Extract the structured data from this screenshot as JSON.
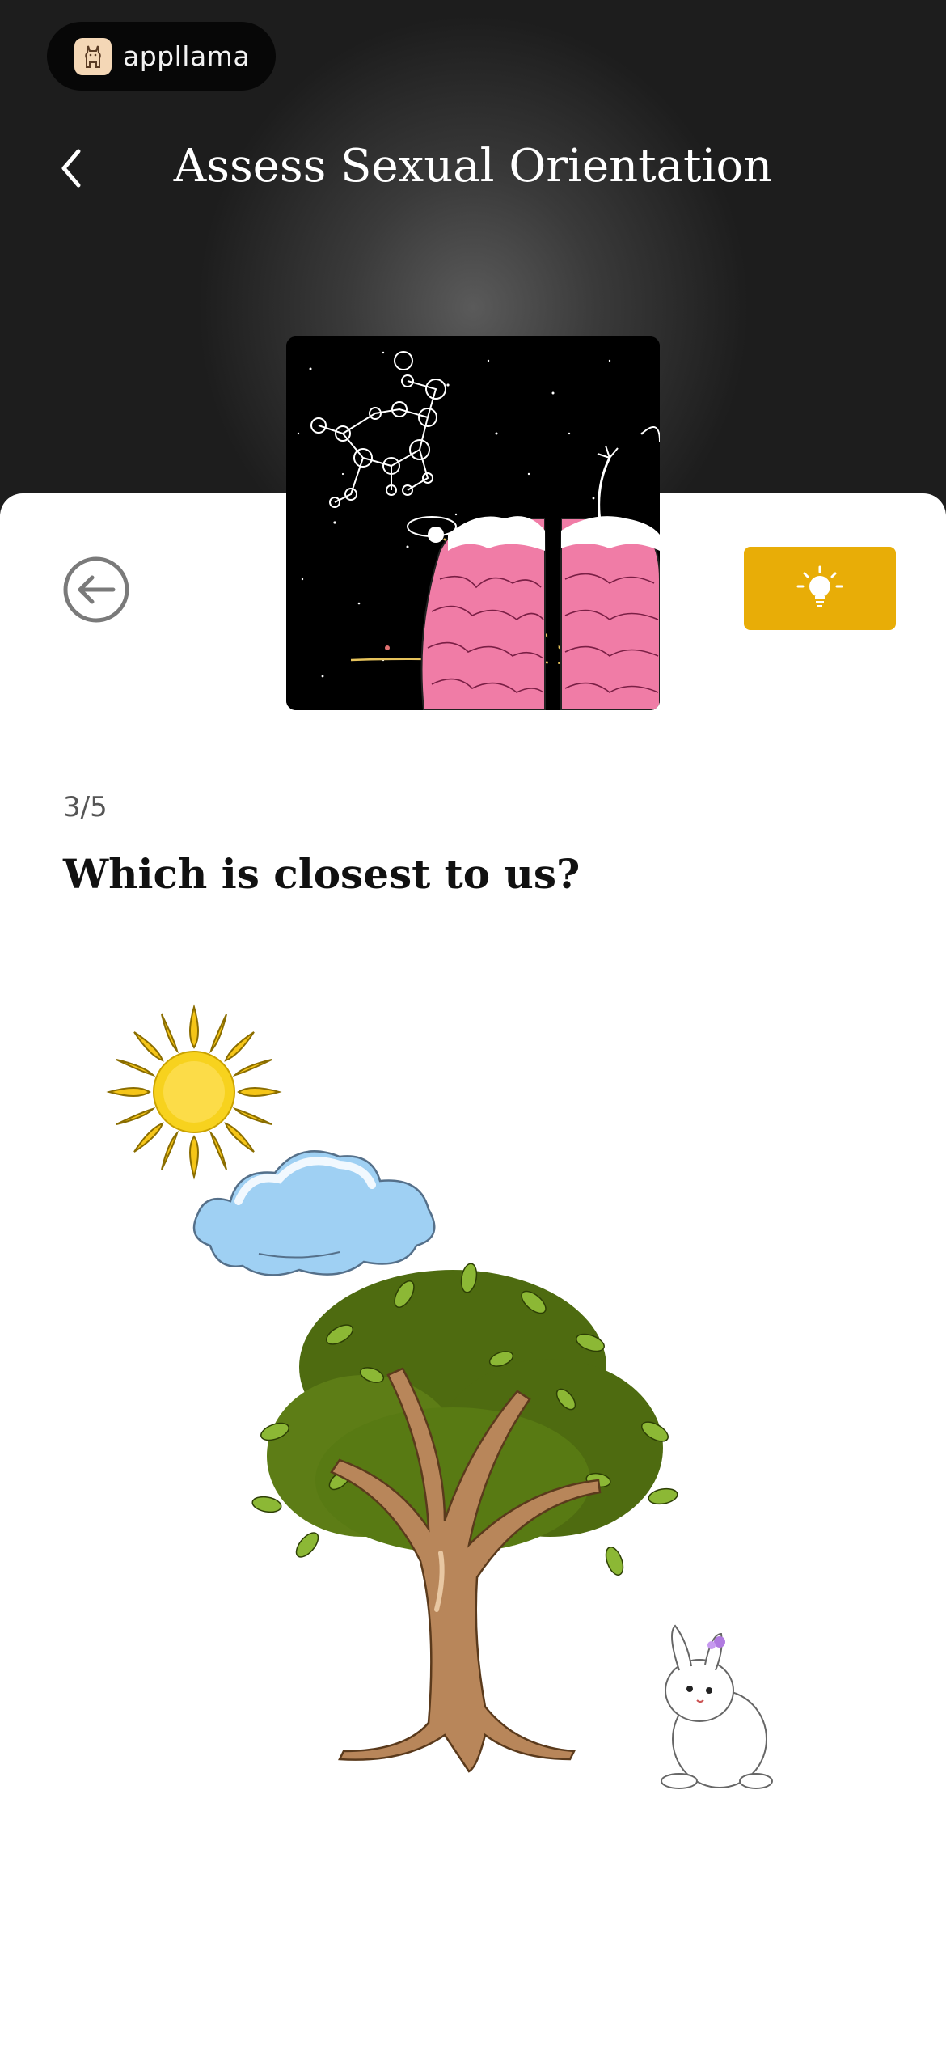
{
  "brand": {
    "name": "appllama",
    "logo_icon": "llama-logo-icon"
  },
  "header": {
    "title": "Assess Sexual Orientation",
    "back_icon": "chevron-left-icon"
  },
  "quiz": {
    "progress": "3/5",
    "question": "Which is closest to us?",
    "back_icon": "circle-arrow-left-icon",
    "hint_icon": "lightbulb-icon",
    "hint_color": "#e8ad07",
    "header_image": "brain-constellation-image",
    "answer_illustration": "sun-cloud-tree-rabbit-illustration"
  }
}
